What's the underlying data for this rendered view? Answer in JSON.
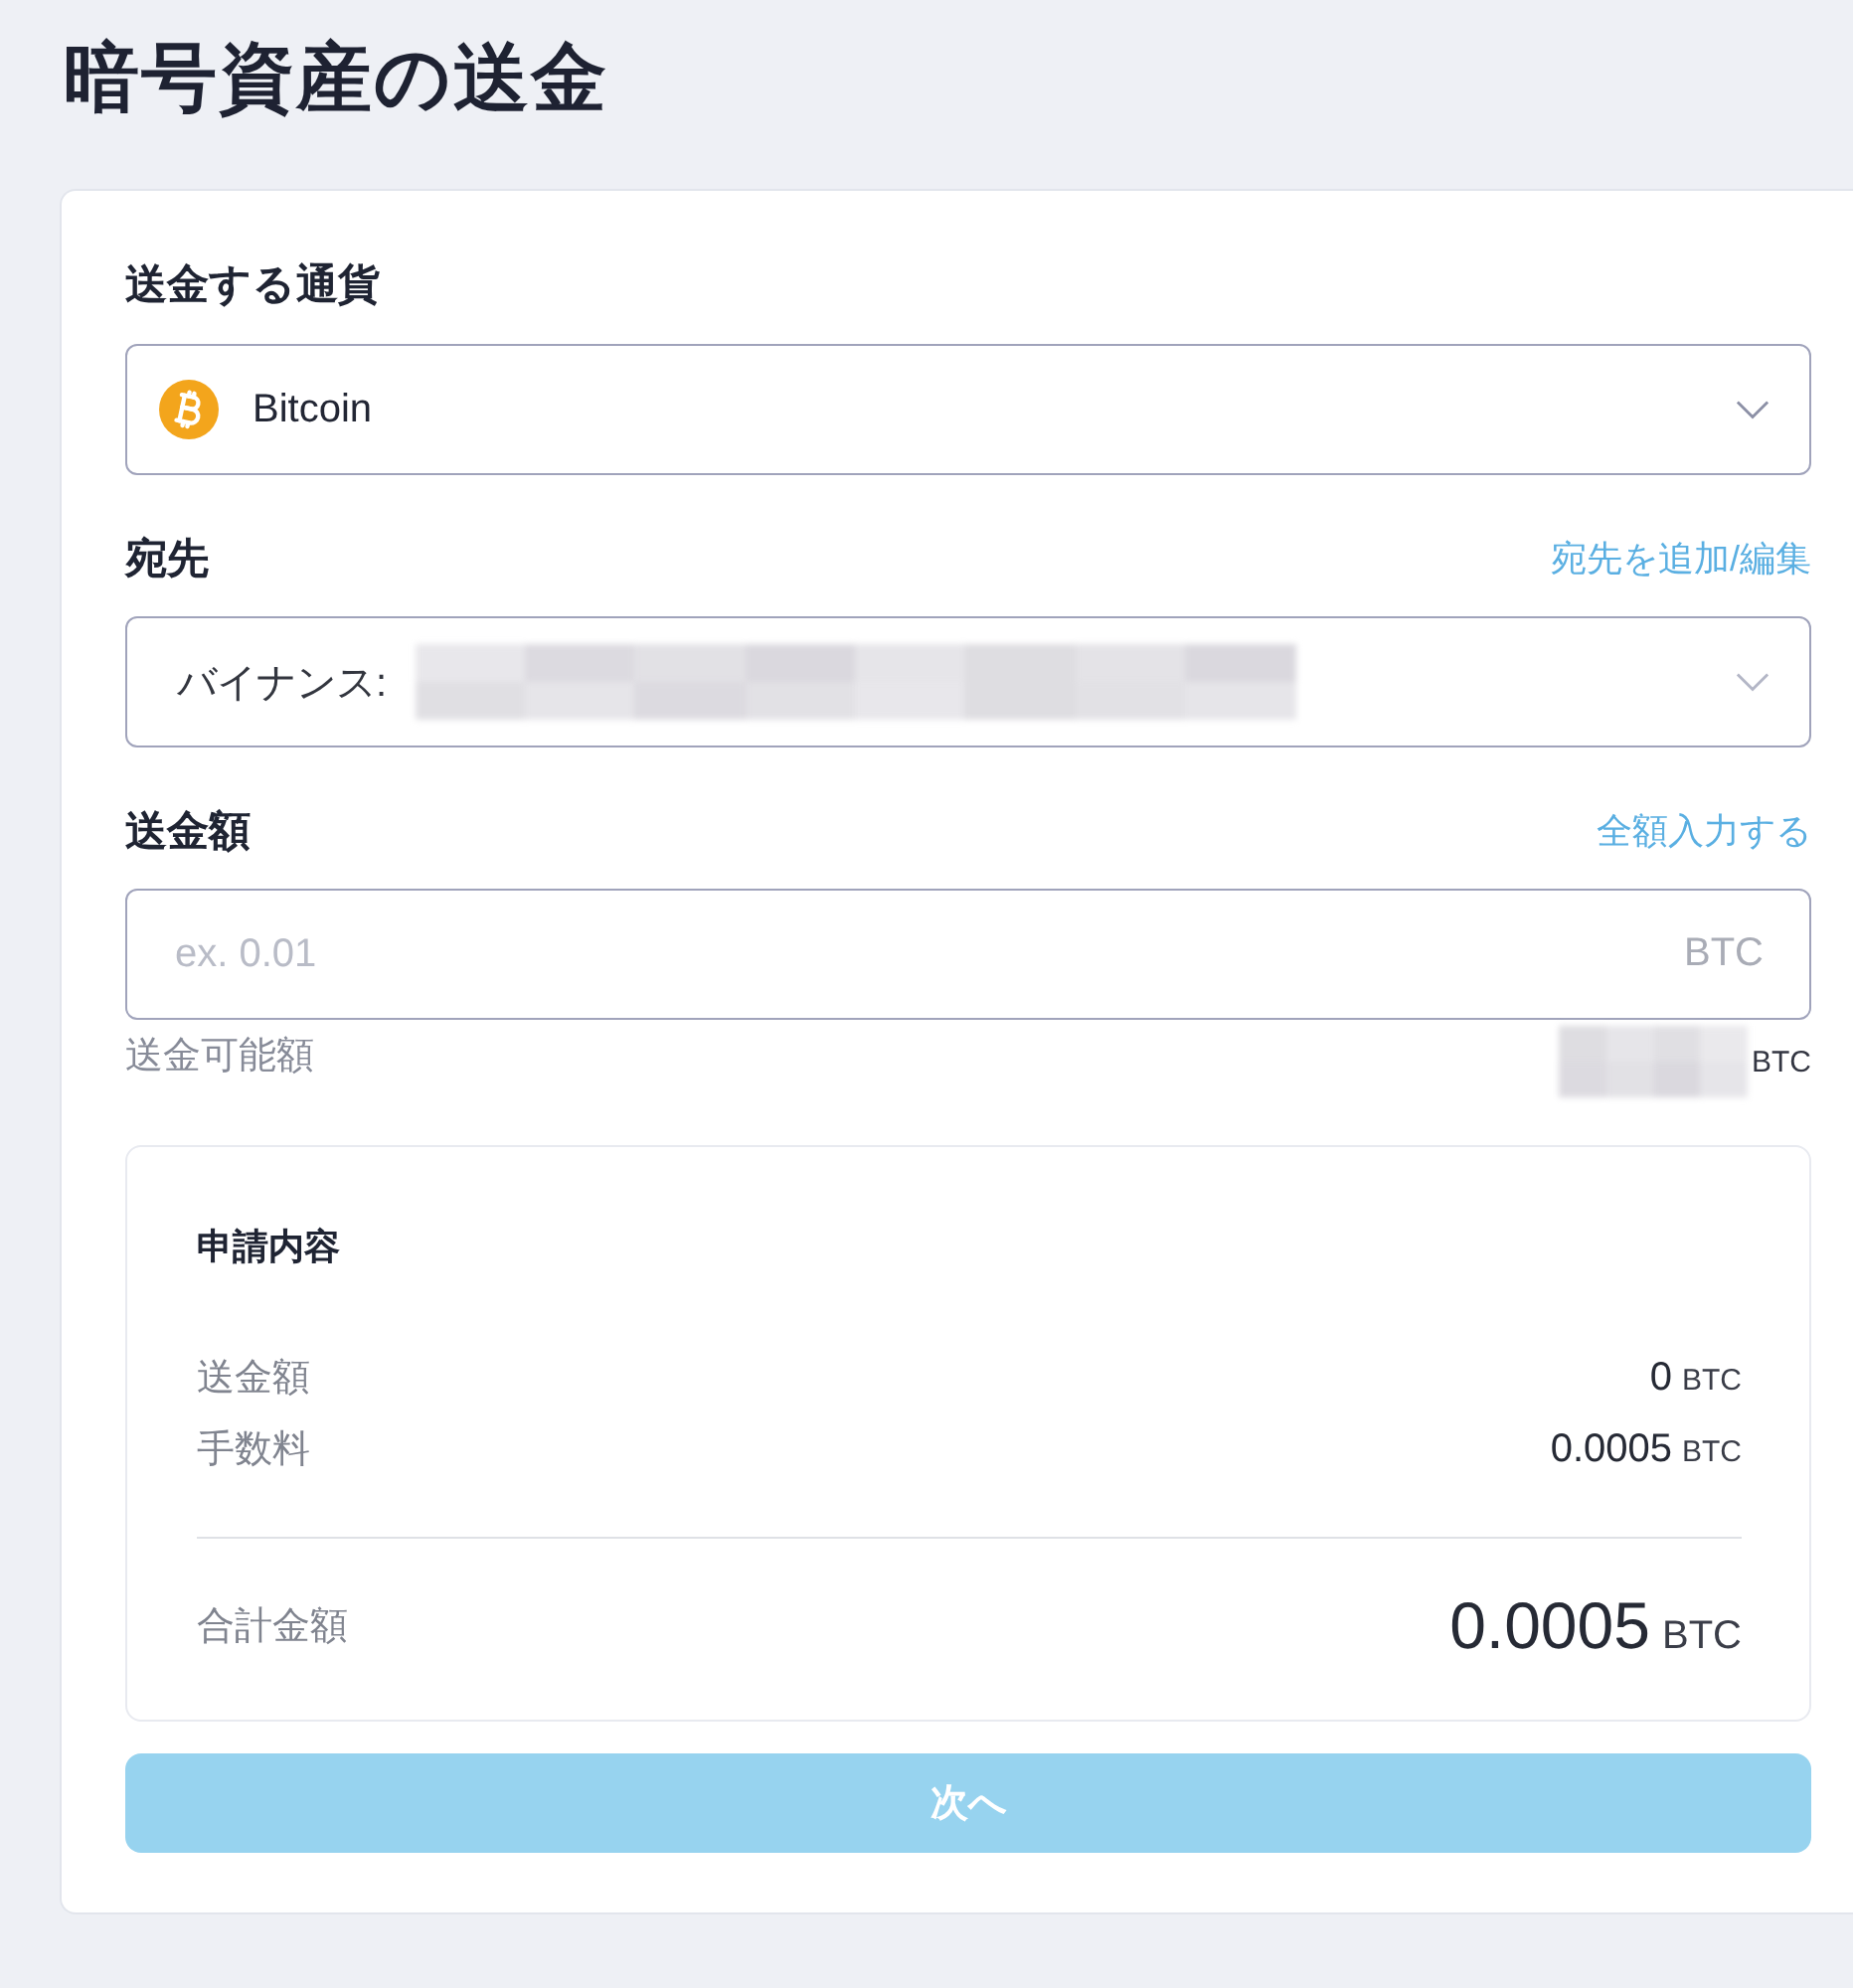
{
  "page": {
    "title": "暗号資産の送金"
  },
  "currency": {
    "label": "送金する通貨",
    "value": "Bitcoin"
  },
  "destination": {
    "label": "宛先",
    "action_link": "宛先を追加/編集",
    "value": "バイナンス:",
    "value_redacted": true
  },
  "amount": {
    "label": "送金額",
    "action_link": "全額入力する",
    "placeholder": "ex. 0.01",
    "unit": "BTC",
    "available_label": "送金可能額",
    "available_redacted": true,
    "available_unit": "BTC"
  },
  "summary": {
    "title": "申請内容",
    "rows": [
      {
        "label": "送金額",
        "value": "0",
        "unit": "BTC"
      },
      {
        "label": "手数料",
        "value": "0.0005",
        "unit": "BTC"
      }
    ],
    "total": {
      "label": "合計金額",
      "value": "0.0005",
      "unit": "BTC"
    }
  },
  "next_button": {
    "label": "次へ",
    "disabled": true
  }
}
